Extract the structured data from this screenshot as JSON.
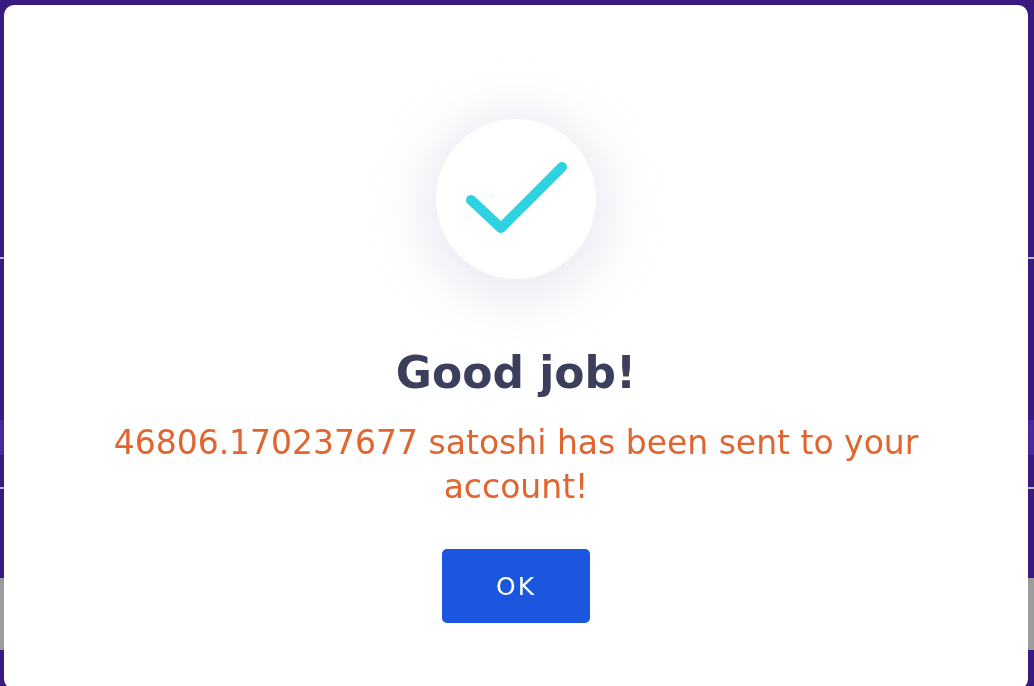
{
  "dialog": {
    "title": "Good job!",
    "message": "46806.170237677 satoshi has been sent to your account!",
    "buttons": [
      "OK"
    ]
  }
}
